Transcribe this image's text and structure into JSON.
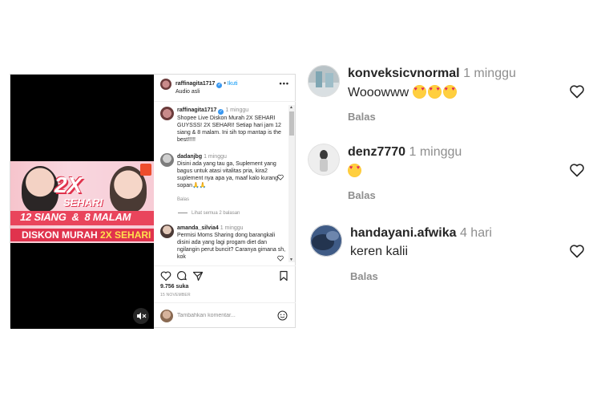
{
  "post": {
    "username": "raffinagita1717",
    "follow_label": "Ikuti",
    "audio_label": "Audio asli",
    "more_label": "•••",
    "video": {
      "headline": "2X",
      "subheadline": "SEHARI",
      "times_text": "12 SIANG  &  8 MALAM",
      "promo_text": "DISKON MURAH",
      "promo_highlight": "2X SEHARI",
      "mute_icon": "speaker-muted-icon"
    },
    "caption": {
      "username": "raffinagita1717",
      "time": "1 minggu",
      "text": "Shopee Live Diskon Murah 2X SEHARI GUYSSS! 2X SEHARI! Setiap hari jam 12 siang & 8 malam. Ini sih top mantap is the best!!!!!"
    },
    "comments": [
      {
        "username": "dadanjbg",
        "time": "1 minggu",
        "text": "Disini ada yang tau ga, Suplement yang bagus untuk atasi vitalitas pria, kira2 suplement nya apa ya, maaf kalo kurang sopan🙏🙏",
        "reply_label": "Balas",
        "view_replies_label": "Lihat semua 2 balasan"
      },
      {
        "username": "amanda_silvia4",
        "time": "1 minggu",
        "text": "Permisi Moms Sharing dong barangkali disini ada yang lagi progam diet dan ngilangin perut buncit? Caranya gimana sh, kok"
      }
    ],
    "likes": "9.756 suka",
    "date": "15 NOVEMBER",
    "add_comment_placeholder": "Tambahkan komentar..."
  },
  "right_comments": [
    {
      "username": "konveksicvnormal",
      "time": "1 minggu",
      "text": "Wooowww",
      "emojis": [
        "heart-eyes-emoji",
        "heart-eyes-emoji",
        "heart-eyes-emoji"
      ],
      "reply_label": "Balas"
    },
    {
      "username": "denz7770",
      "time": "1 minggu",
      "text": "",
      "emojis": [
        "heart-eyes-emoji"
      ],
      "reply_label": "Balas"
    },
    {
      "username": "handayani.afwika",
      "time": "4 hari",
      "text": "keren kalii",
      "emojis": [],
      "reply_label": "Balas"
    }
  ],
  "colors": {
    "link_blue": "#0095f6",
    "muted_gray": "#8e8e8e",
    "promo_red": "#e0334d",
    "banner_pink": "#f7ccd6"
  }
}
